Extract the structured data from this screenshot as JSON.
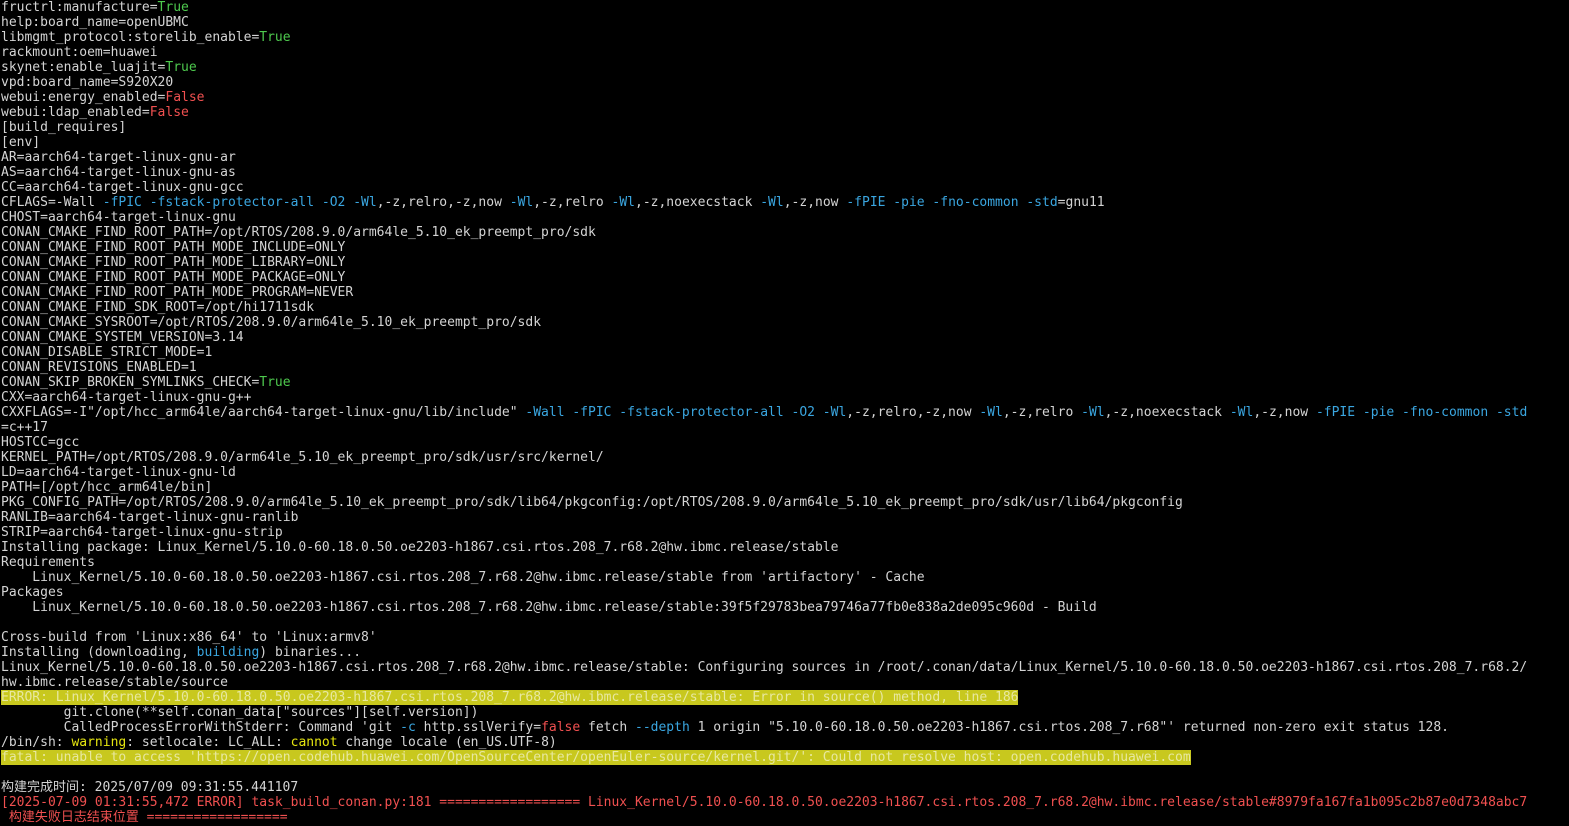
{
  "terminal": {
    "colors": {
      "background": "#000000",
      "default": "#d4d4d4",
      "green": "#4ec94e",
      "red": "#f05050",
      "blue": "#3aa6e0",
      "yellow": "#e5e510",
      "highlight_bg": "#c8c81e",
      "highlight_fg": "#e8e8a0"
    },
    "lines": [
      [
        {
          "t": "fructrl:manufacture=",
          "c": "default"
        },
        {
          "t": "True",
          "c": "green"
        }
      ],
      [
        {
          "t": "help:board_name=openUBMC",
          "c": "default"
        }
      ],
      [
        {
          "t": "libmgmt_protocol:storelib_enable=",
          "c": "default"
        },
        {
          "t": "True",
          "c": "green"
        }
      ],
      [
        {
          "t": "rackmount:oem=huawei",
          "c": "default"
        }
      ],
      [
        {
          "t": "skynet:enable_luajit=",
          "c": "default"
        },
        {
          "t": "True",
          "c": "green"
        }
      ],
      [
        {
          "t": "vpd:board_name=S920X20",
          "c": "default"
        }
      ],
      [
        {
          "t": "webui:energy_enabled=",
          "c": "default"
        },
        {
          "t": "False",
          "c": "red"
        }
      ],
      [
        {
          "t": "webui:ldap_enabled=",
          "c": "default"
        },
        {
          "t": "False",
          "c": "red"
        }
      ],
      [
        {
          "t": "[build_requires]",
          "c": "default"
        }
      ],
      [
        {
          "t": "[env]",
          "c": "default"
        }
      ],
      [
        {
          "t": "AR=aarch64-target-linux-gnu-ar",
          "c": "default"
        }
      ],
      [
        {
          "t": "AS=aarch64-target-linux-gnu-as",
          "c": "default"
        }
      ],
      [
        {
          "t": "CC=aarch64-target-linux-gnu-gcc",
          "c": "default"
        }
      ],
      [
        {
          "t": "CFLAGS=-Wall ",
          "c": "default"
        },
        {
          "t": "-fPIC -fstack-protector-all -O2 -Wl",
          "c": "blue"
        },
        {
          "t": ",-z,relro,-z,now ",
          "c": "default"
        },
        {
          "t": "-Wl",
          "c": "blue"
        },
        {
          "t": ",-z,relro ",
          "c": "default"
        },
        {
          "t": "-Wl",
          "c": "blue"
        },
        {
          "t": ",-z,noexecstack ",
          "c": "default"
        },
        {
          "t": "-Wl",
          "c": "blue"
        },
        {
          "t": ",-z,now ",
          "c": "default"
        },
        {
          "t": "-fPIE -pie -fno-common -std",
          "c": "blue"
        },
        {
          "t": "=gnu11",
          "c": "default"
        }
      ],
      [
        {
          "t": "CHOST=aarch64-target-linux-gnu",
          "c": "default"
        }
      ],
      [
        {
          "t": "CONAN_CMAKE_FIND_ROOT_PATH=/opt/RTOS/208.9.0/arm64le_5.10_ek_preempt_pro/sdk",
          "c": "default"
        }
      ],
      [
        {
          "t": "CONAN_CMAKE_FIND_ROOT_PATH_MODE_INCLUDE=ONLY",
          "c": "default"
        }
      ],
      [
        {
          "t": "CONAN_CMAKE_FIND_ROOT_PATH_MODE_LIBRARY=ONLY",
          "c": "default"
        }
      ],
      [
        {
          "t": "CONAN_CMAKE_FIND_ROOT_PATH_MODE_PACKAGE=ONLY",
          "c": "default"
        }
      ],
      [
        {
          "t": "CONAN_CMAKE_FIND_ROOT_PATH_MODE_PROGRAM=NEVER",
          "c": "default"
        }
      ],
      [
        {
          "t": "CONAN_CMAKE_FIND_SDK_ROOT=/opt/hi1711sdk",
          "c": "default"
        }
      ],
      [
        {
          "t": "CONAN_CMAKE_SYSROOT=/opt/RTOS/208.9.0/arm64le_5.10_ek_preempt_pro/sdk",
          "c": "default"
        }
      ],
      [
        {
          "t": "CONAN_CMAKE_SYSTEM_VERSION=3.14",
          "c": "default"
        }
      ],
      [
        {
          "t": "CONAN_DISABLE_STRICT_MODE=1",
          "c": "default"
        }
      ],
      [
        {
          "t": "CONAN_REVISIONS_ENABLED=1",
          "c": "default"
        }
      ],
      [
        {
          "t": "CONAN_SKIP_BROKEN_SYMLINKS_CHECK=",
          "c": "default"
        },
        {
          "t": "True",
          "c": "green"
        }
      ],
      [
        {
          "t": "CXX=aarch64-target-linux-gnu-g++",
          "c": "default"
        }
      ],
      [
        {
          "t": "CXXFLAGS=-I\"/opt/hcc_arm64le/aarch64-target-linux-gnu/lib/include\" ",
          "c": "default"
        },
        {
          "t": "-Wall -fPIC -fstack-protector-all -O2 -Wl",
          "c": "blue"
        },
        {
          "t": ",-z,relro,-z,now ",
          "c": "default"
        },
        {
          "t": "-Wl",
          "c": "blue"
        },
        {
          "t": ",-z,relro ",
          "c": "default"
        },
        {
          "t": "-Wl",
          "c": "blue"
        },
        {
          "t": ",-z,noexecstack ",
          "c": "default"
        },
        {
          "t": "-Wl",
          "c": "blue"
        },
        {
          "t": ",-z,now ",
          "c": "default"
        },
        {
          "t": "-fPIE -pie -fno-common -std",
          "c": "blue"
        }
      ],
      [
        {
          "t": "=c++17",
          "c": "default"
        }
      ],
      [
        {
          "t": "HOSTCC=gcc",
          "c": "default"
        }
      ],
      [
        {
          "t": "KERNEL_PATH=/opt/RTOS/208.9.0/arm64le_5.10_ek_preempt_pro/sdk/usr/src/kernel/",
          "c": "default"
        }
      ],
      [
        {
          "t": "LD=aarch64-target-linux-gnu-ld",
          "c": "default"
        }
      ],
      [
        {
          "t": "PATH=[/opt/hcc_arm64le/bin]",
          "c": "default"
        }
      ],
      [
        {
          "t": "PKG_CONFIG_PATH=/opt/RTOS/208.9.0/arm64le_5.10_ek_preempt_pro/sdk/lib64/pkgconfig:/opt/RTOS/208.9.0/arm64le_5.10_ek_preempt_pro/sdk/usr/lib64/pkgconfig",
          "c": "default"
        }
      ],
      [
        {
          "t": "RANLIB=aarch64-target-linux-gnu-ranlib",
          "c": "default"
        }
      ],
      [
        {
          "t": "STRIP=aarch64-target-linux-gnu-strip",
          "c": "default"
        }
      ],
      [
        {
          "t": "Installing package: Linux_Kernel/5.10.0-60.18.0.50.oe2203-h1867.csi.rtos.208_7.r68.2@hw.ibmc.release/stable",
          "c": "default"
        }
      ],
      [
        {
          "t": "Requirements",
          "c": "default"
        }
      ],
      [
        {
          "t": "    Linux_Kernel/5.10.0-60.18.0.50.oe2203-h1867.csi.rtos.208_7.r68.2@hw.ibmc.release/stable from 'artifactory' - Cache",
          "c": "default"
        }
      ],
      [
        {
          "t": "Packages",
          "c": "default"
        }
      ],
      [
        {
          "t": "    Linux_Kernel/5.10.0-60.18.0.50.oe2203-h1867.csi.rtos.208_7.r68.2@hw.ibmc.release/stable:39f5f29783bea79746a77fb0e838a2de095c960d - Build",
          "c": "default"
        }
      ],
      [
        {
          "t": "",
          "c": "default"
        }
      ],
      [
        {
          "t": "Cross-build from 'Linux:x86_64' to 'Linux:armv8'",
          "c": "default"
        }
      ],
      [
        {
          "t": "Installing (downloading, ",
          "c": "default"
        },
        {
          "t": "building",
          "c": "blue"
        },
        {
          "t": ") binaries...",
          "c": "default"
        }
      ],
      [
        {
          "t": "Linux_Kernel/5.10.0-60.18.0.50.oe2203-h1867.csi.rtos.208_7.r68.2@hw.ibmc.release/stable: Configuring sources in /root/.conan/data/Linux_Kernel/5.10.0-60.18.0.50.oe2203-h1867.csi.rtos.208_7.r68.2/",
          "c": "default"
        }
      ],
      [
        {
          "t": "hw.ibmc.release/stable/source",
          "c": "default"
        }
      ],
      [
        {
          "t": "ERROR: Linux_Kernel/5.10.0-60.18.0.50.oe2203-h1867.csi.rtos.208_7.r68.2@hw.ibmc.release/stable: Error in source() method, line 186",
          "c": "hl"
        }
      ],
      [
        {
          "t": "        git.clone(**self.conan_data[\"sources\"][self.version])",
          "c": "default"
        }
      ],
      [
        {
          "t": "        CalledProcessErrorWithStderr: Command 'git ",
          "c": "default"
        },
        {
          "t": "-c",
          "c": "blue"
        },
        {
          "t": " http.sslVerify=",
          "c": "default"
        },
        {
          "t": "false",
          "c": "red"
        },
        {
          "t": " fetch ",
          "c": "default"
        },
        {
          "t": "--depth",
          "c": "blue"
        },
        {
          "t": " 1 origin \"5.10.0-60.18.0.50.oe2203-h1867.csi.rtos.208_7.r68\"' returned non-zero exit status 128.",
          "c": "default"
        }
      ],
      [
        {
          "t": "/bin/sh: ",
          "c": "default"
        },
        {
          "t": "warning",
          "c": "yellow"
        },
        {
          "t": ": setlocale: LC_ALL: ",
          "c": "default"
        },
        {
          "t": "cannot",
          "c": "yellow"
        },
        {
          "t": " change locale (en_US.UTF-8)",
          "c": "default"
        }
      ],
      [
        {
          "t": "fatal: unable to access 'https://open.codehub.huawei.com/OpenSourceCenter/openEuler-source/kernel.git/': Could not resolve host: open.codehub.huawei.com",
          "c": "hl"
        }
      ],
      [
        {
          "t": "",
          "c": "default"
        }
      ],
      [
        {
          "t": "构建完成时间: 2025/07/09 09:31:55.441107",
          "c": "default"
        }
      ],
      [
        {
          "t": "[2025-07-09 01:31:55,472 ERROR] task_build_conan.py:181 ================== Linux_Kernel/5.10.0-60.18.0.50.oe2203-h1867.csi.rtos.208_7.r68.2@hw.ibmc.release/stable#8979fa167fa1b095c2b87e0d7348abc7",
          "c": "red"
        }
      ],
      [
        {
          "t": " 构建失败日志结束位置 ==================",
          "c": "red"
        }
      ]
    ]
  }
}
